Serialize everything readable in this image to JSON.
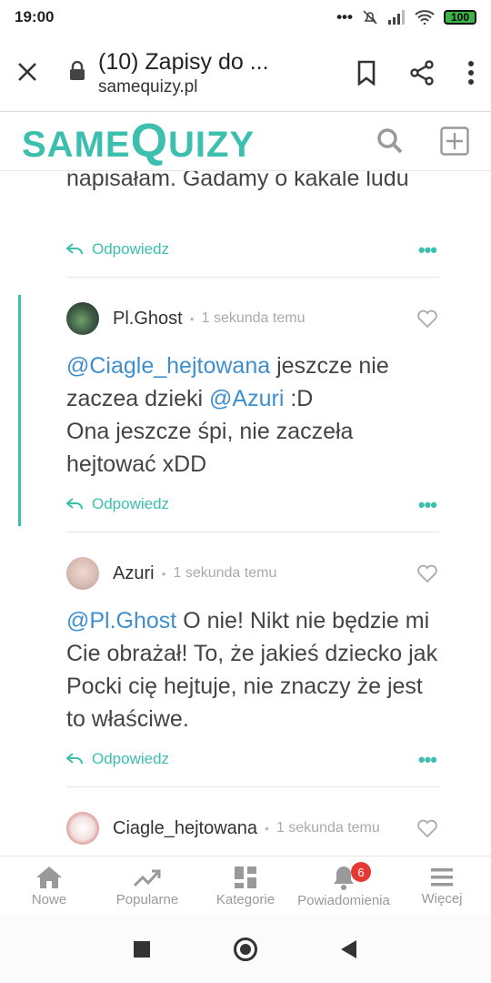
{
  "status": {
    "time": "19:00",
    "battery": "100"
  },
  "browser": {
    "title": "(10) Zapisy do ...",
    "domain": "samequizy.pl"
  },
  "site": {
    "logo_left": "SAME",
    "logo_q": "Q",
    "logo_right": "UIZY"
  },
  "fragment": {
    "text": "napisałam. Gadamy o kakale ludu",
    "reply_label": "Odpowiedz"
  },
  "comments": [
    {
      "author": "Pl.Ghost",
      "time": "1 sekunda temu",
      "mention1": "@Ciagle_hejtowana",
      "text1": " jeszcze nie zaczea dzieki ",
      "mention2": "@Azuri",
      "text2": " :D",
      "line2": "Ona jeszcze śpi, nie zaczeła hejtować xDD",
      "reply_label": "Odpowiedz"
    },
    {
      "author": "Azuri",
      "time": "1 sekunda temu",
      "mention1": "@Pl.Ghost",
      "text1": " O nie! Nikt nie będzie mi Cie obrażał! To, że jakieś dziecko jak Pocki cię hejtuje, nie znaczy że jest to właściwe.",
      "reply_label": "Odpowiedz"
    },
    {
      "author": "Ciagle_hejtowana",
      "time": "1 sekunda temu"
    }
  ],
  "nav": [
    {
      "label": "Nowe",
      "icon": "home-icon"
    },
    {
      "label": "Popularne",
      "icon": "trending-icon"
    },
    {
      "label": "Kategorie",
      "icon": "grid-icon"
    },
    {
      "label": "Powiadomienia",
      "icon": "bell-icon",
      "badge": "6"
    },
    {
      "label": "Więcej",
      "icon": "menu-icon"
    }
  ],
  "colors": {
    "accent": "#3cbfae",
    "mention": "#3f8fcf",
    "badge": "#e53935"
  }
}
